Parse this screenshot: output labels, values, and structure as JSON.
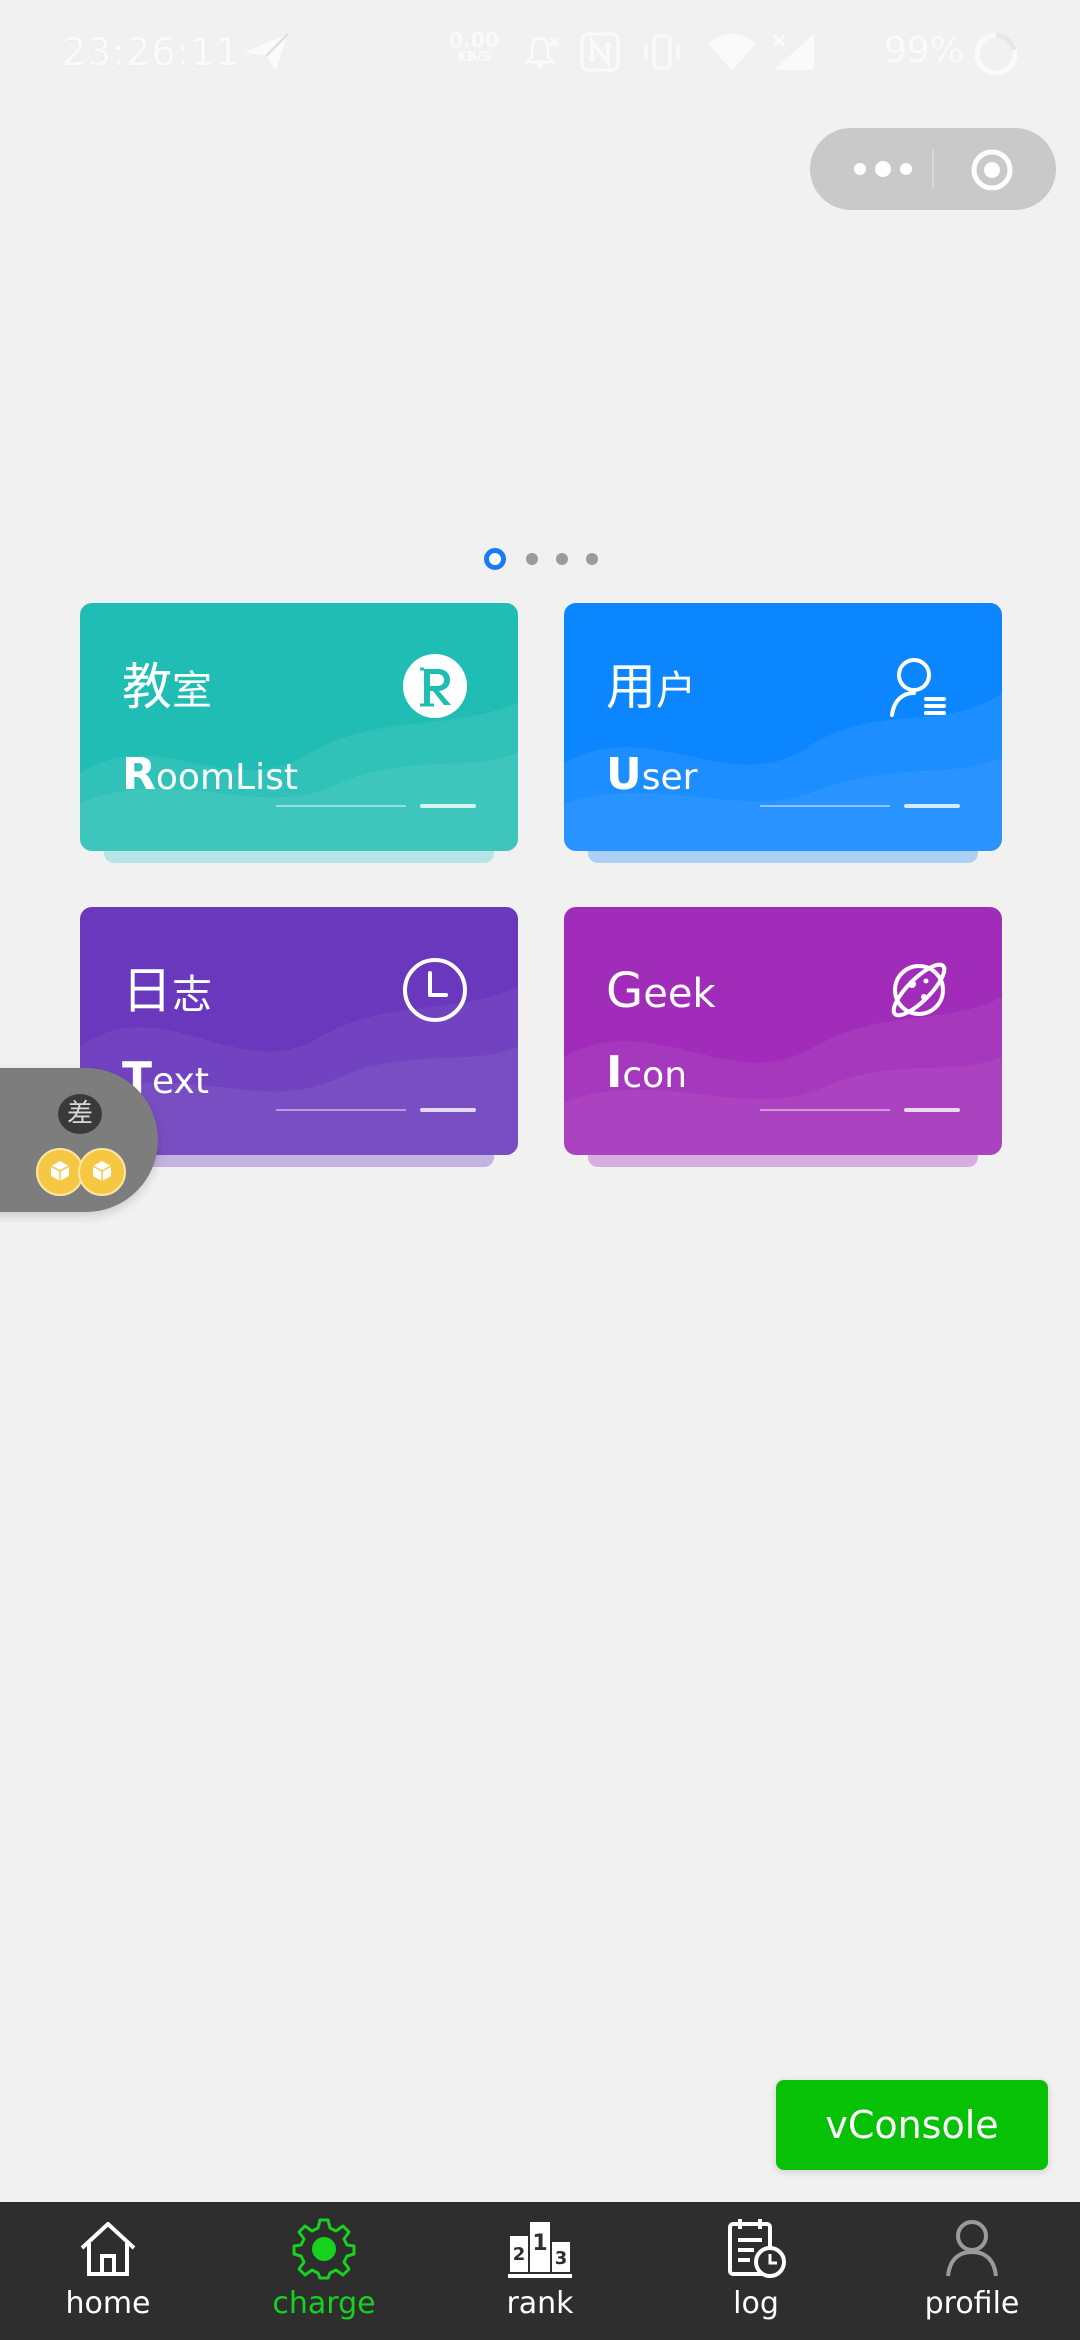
{
  "status_bar": {
    "time": "23:26:11",
    "net_speed_value": "0.00",
    "net_speed_unit": "KB/S",
    "battery_percent": "99%"
  },
  "swiper": {
    "page_count": 4,
    "active_index": 0
  },
  "cards": [
    {
      "title_big": "教",
      "title_small": "室",
      "sub_cap": "R",
      "sub_rest": "oomList",
      "icon": "r-badge-icon",
      "color": "#1fbdb3"
    },
    {
      "title_big": "用",
      "title_small": "户",
      "sub_cap": "U",
      "sub_rest": "ser",
      "icon": "user-list-icon",
      "color": "#0b86ff"
    },
    {
      "title_big": "日",
      "title_small": "志",
      "sub_cap": "T",
      "sub_rest": "ext",
      "icon": "clock-icon",
      "color": "#6a38bd"
    },
    {
      "title_big": "G",
      "title_small": "eek",
      "sub_cap": "I",
      "sub_rest": "con",
      "icon": "planet-icon",
      "color": "#a12cba"
    }
  ],
  "float_widget": {
    "badge": "差"
  },
  "vconsole": {
    "label": "vConsole",
    "color": "#07c107"
  },
  "tabbar": {
    "active_color": "#17d11f",
    "tabs": [
      {
        "label": "home",
        "icon": "home-icon"
      },
      {
        "label": "charge",
        "icon": "gear-icon"
      },
      {
        "label": "rank",
        "icon": "podium-icon"
      },
      {
        "label": "log",
        "icon": "calendar-clock-icon"
      },
      {
        "label": "profile",
        "icon": "person-icon"
      }
    ],
    "active_index": 1
  }
}
